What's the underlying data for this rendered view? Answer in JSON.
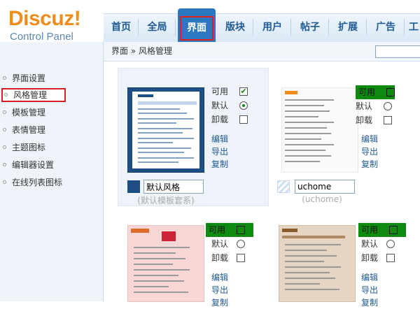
{
  "logo": {
    "brand": "Discuz!",
    "subtitle": "Control Panel"
  },
  "nav": {
    "items": [
      {
        "label": "首页",
        "active": false
      },
      {
        "label": "全局",
        "active": false
      },
      {
        "label": "界面",
        "active": true
      },
      {
        "label": "版块",
        "active": false
      },
      {
        "label": "用户",
        "active": false
      },
      {
        "label": "帖子",
        "active": false
      },
      {
        "label": "扩展",
        "active": false
      },
      {
        "label": "广告",
        "active": false
      },
      {
        "label": "工",
        "active": false
      }
    ]
  },
  "breadcrumb": "界面 » 风格管理",
  "search": {
    "value": "",
    "placeholder": ""
  },
  "sidebar": {
    "items": [
      {
        "label": "界面设置"
      },
      {
        "label": "风格管理",
        "active": true
      },
      {
        "label": "模板管理"
      },
      {
        "label": "表情管理"
      },
      {
        "label": "主题图标"
      },
      {
        "label": "编辑器设置"
      },
      {
        "label": "在线列表图标"
      }
    ]
  },
  "styles": [
    {
      "name": "默认风格",
      "caption": "(默认模板套系)",
      "thumb_label": "Discuz!",
      "options": {
        "available": "可用",
        "default": "默认",
        "uninstall": "卸载"
      },
      "links": {
        "edit": "编辑",
        "export": "导出",
        "copy": "复制"
      },
      "available_checked": true,
      "is_default": true,
      "swatch_color": "#1d4f86"
    },
    {
      "name": "uchome",
      "caption": "(uchome)",
      "thumb_label": "UCHome",
      "options": {
        "available": "可用",
        "default": "默认",
        "uninstall": "卸载"
      },
      "links": {
        "edit": "编辑",
        "export": "导出",
        "copy": "复制"
      },
      "available_checked": false,
      "is_default": false,
      "swatch_color": "#dbe9f6"
    },
    {
      "name": "",
      "caption": "",
      "thumb_label": "Discuz!",
      "options": {
        "available": "可用",
        "default": "默认",
        "uninstall": "卸载"
      },
      "links": {
        "edit": "编辑",
        "export": "导出",
        "copy": "复制"
      },
      "available_checked": false,
      "is_default": false
    },
    {
      "name": "",
      "caption": "",
      "thumb_label": "DISCUZ!",
      "options": {
        "available": "可用",
        "default": "默认",
        "uninstall": "卸载"
      },
      "links": {
        "edit": "编辑",
        "export": "导出",
        "copy": "复制"
      },
      "available_checked": false,
      "is_default": false
    }
  ],
  "colors": {
    "accent": "#2a78bf",
    "nav_text": "#1f5a94",
    "available_bar": "#0e8a10",
    "highlight": "#d92020",
    "logo_orange": "#f08c1a"
  }
}
